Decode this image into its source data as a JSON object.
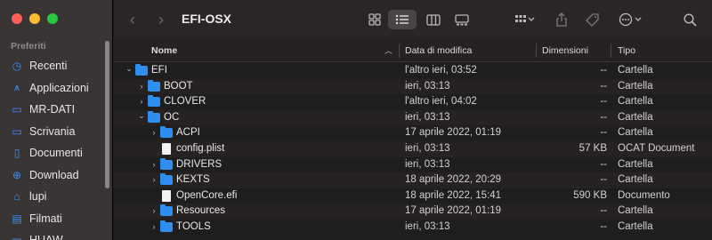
{
  "window": {
    "title": "EFI-OSX"
  },
  "sidebar": {
    "heading": "Preferiti",
    "items": [
      {
        "label": "Recenti",
        "icon": "clock-icon"
      },
      {
        "label": "Applicazioni",
        "icon": "applications-icon"
      },
      {
        "label": "MR-DATI",
        "icon": "drive-icon"
      },
      {
        "label": "Scrivania",
        "icon": "desktop-icon"
      },
      {
        "label": "Documenti",
        "icon": "document-icon"
      },
      {
        "label": "Download",
        "icon": "download-icon"
      },
      {
        "label": "lupi",
        "icon": "home-icon"
      },
      {
        "label": "Filmati",
        "icon": "film-icon"
      },
      {
        "label": "HUAW",
        "icon": "drive-icon"
      }
    ]
  },
  "columns": {
    "name": "Nome",
    "date": "Data di modifica",
    "size": "Dimensioni",
    "kind": "Tipo"
  },
  "rows": [
    {
      "name": "EFI",
      "date": "l'altro ieri, 03:52",
      "size": "--",
      "kind": "Cartella",
      "type": "folder",
      "depth": 0,
      "expanded": true
    },
    {
      "name": "BOOT",
      "date": "ieri, 03:13",
      "size": "--",
      "kind": "Cartella",
      "type": "folder",
      "depth": 1,
      "expanded": false
    },
    {
      "name": "CLOVER",
      "date": "l'altro ieri, 04:02",
      "size": "--",
      "kind": "Cartella",
      "type": "folder",
      "depth": 1,
      "expanded": false
    },
    {
      "name": "OC",
      "date": "ieri, 03:13",
      "size": "--",
      "kind": "Cartella",
      "type": "folder",
      "depth": 1,
      "expanded": true
    },
    {
      "name": "ACPI",
      "date": "17 aprile 2022, 01:19",
      "size": "--",
      "kind": "Cartella",
      "type": "folder",
      "depth": 2,
      "expanded": false
    },
    {
      "name": "config.plist",
      "date": "ieri, 03:13",
      "size": "57 KB",
      "kind": "OCAT Document",
      "type": "file",
      "depth": 2
    },
    {
      "name": "DRIVERS",
      "date": "ieri, 03:13",
      "size": "--",
      "kind": "Cartella",
      "type": "folder",
      "depth": 2,
      "expanded": false
    },
    {
      "name": "KEXTS",
      "date": "18 aprile 2022, 20:29",
      "size": "--",
      "kind": "Cartella",
      "type": "folder",
      "depth": 2,
      "expanded": false
    },
    {
      "name": "OpenCore.efi",
      "date": "18 aprile 2022, 15:41",
      "size": "590 KB",
      "kind": "Documento",
      "type": "file",
      "depth": 2
    },
    {
      "name": "Resources",
      "date": "17 aprile 2022, 01:19",
      "size": "--",
      "kind": "Cartella",
      "type": "folder",
      "depth": 2,
      "expanded": false
    },
    {
      "name": "TOOLS",
      "date": "ieri, 03:13",
      "size": "--",
      "kind": "Cartella",
      "type": "folder",
      "depth": 2,
      "expanded": false
    }
  ]
}
